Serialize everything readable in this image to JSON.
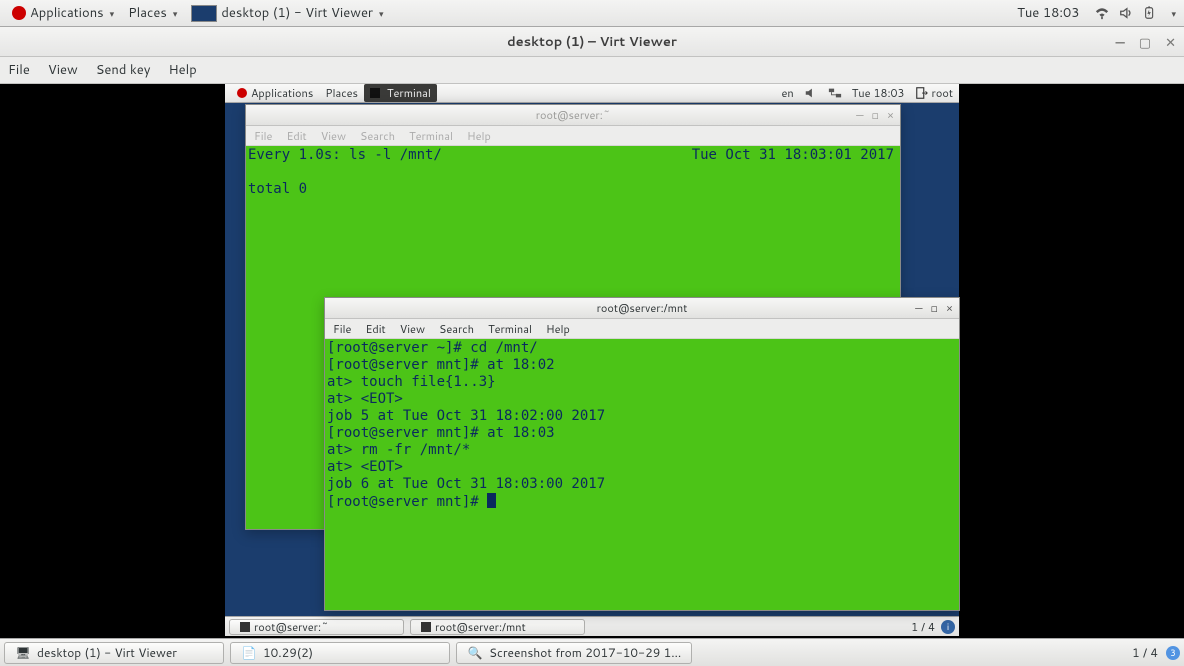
{
  "outer_panel": {
    "apps": "Applications",
    "places": "Places",
    "active_win": "desktop (1) - Virt Viewer",
    "clock": "Tue 18:03"
  },
  "virt": {
    "title": "desktop (1) – Virt Viewer",
    "menu": {
      "file": "File",
      "view": "View",
      "sendkey": "Send key",
      "help": "Help"
    }
  },
  "guest": {
    "panel": {
      "apps": "Applications",
      "places": "Places",
      "terminal": "Terminal",
      "lang": "en",
      "clock": "Tue 18:03",
      "user": "root"
    },
    "taskbar": {
      "items": [
        {
          "label": "root@server:~"
        },
        {
          "label": "root@server:/mnt"
        }
      ],
      "workspace": "1 / 4"
    }
  },
  "term1": {
    "title": "root@server:~",
    "menu": {
      "file": "File",
      "edit": "Edit",
      "view": "View",
      "search": "Search",
      "terminal": "Terminal",
      "help": "Help"
    },
    "watch_header": "Every 1.0s: ls -l /mnt/",
    "watch_ts": "Tue Oct 31 18:03:01 2017",
    "body": "total 0"
  },
  "term2": {
    "title": "root@server:/mnt",
    "menu": {
      "file": "File",
      "edit": "Edit",
      "view": "View",
      "search": "Search",
      "terminal": "Terminal",
      "help": "Help"
    },
    "lines": [
      "[root@server ~]# cd /mnt/",
      "[root@server mnt]# at 18:02",
      "at> touch file{1..3}",
      "at> <EOT>",
      "job 5 at Tue Oct 31 18:02:00 2017",
      "[root@server mnt]# at 18:03",
      "at> rm -fr /mnt/*",
      "at> <EOT>",
      "job 6 at Tue Oct 31 18:03:00 2017",
      "[root@server mnt]# "
    ]
  },
  "outer_task": {
    "items": [
      {
        "label": "desktop (1) - Virt Viewer"
      },
      {
        "label": "10.29(2)"
      },
      {
        "label": "Screenshot from 2017-10-29 1…"
      }
    ],
    "workspace": "1 / 4"
  }
}
